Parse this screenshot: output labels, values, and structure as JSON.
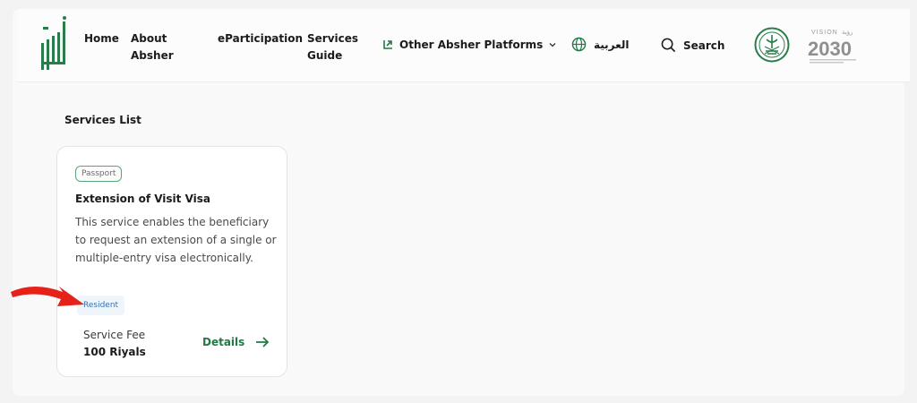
{
  "nav": {
    "home": "Home",
    "about": "About Absher",
    "eparticipation": "eParticipation",
    "services_guide": "Services Guide",
    "platforms": "Other Absher Platforms",
    "language": "العربية",
    "search": "Search"
  },
  "branding": {
    "vision_year": "2030",
    "vision_word": "VISION",
    "accent": "#1f7a46"
  },
  "main": {
    "section_title": "Services List",
    "card": {
      "tag": "Passport",
      "title": "Extension of Visit Visa",
      "description": "This service enables the beneficiary to request an extension of a single or multiple-entry visa electronically.",
      "audience": "Resident",
      "fee_label": "Service Fee",
      "fee_value": "100 Riyals",
      "details": "Details"
    }
  },
  "colors": {
    "annotation_arrow": "#e62117",
    "resident_text": "#3b6fb3",
    "tag_border": "#5aa47a"
  }
}
